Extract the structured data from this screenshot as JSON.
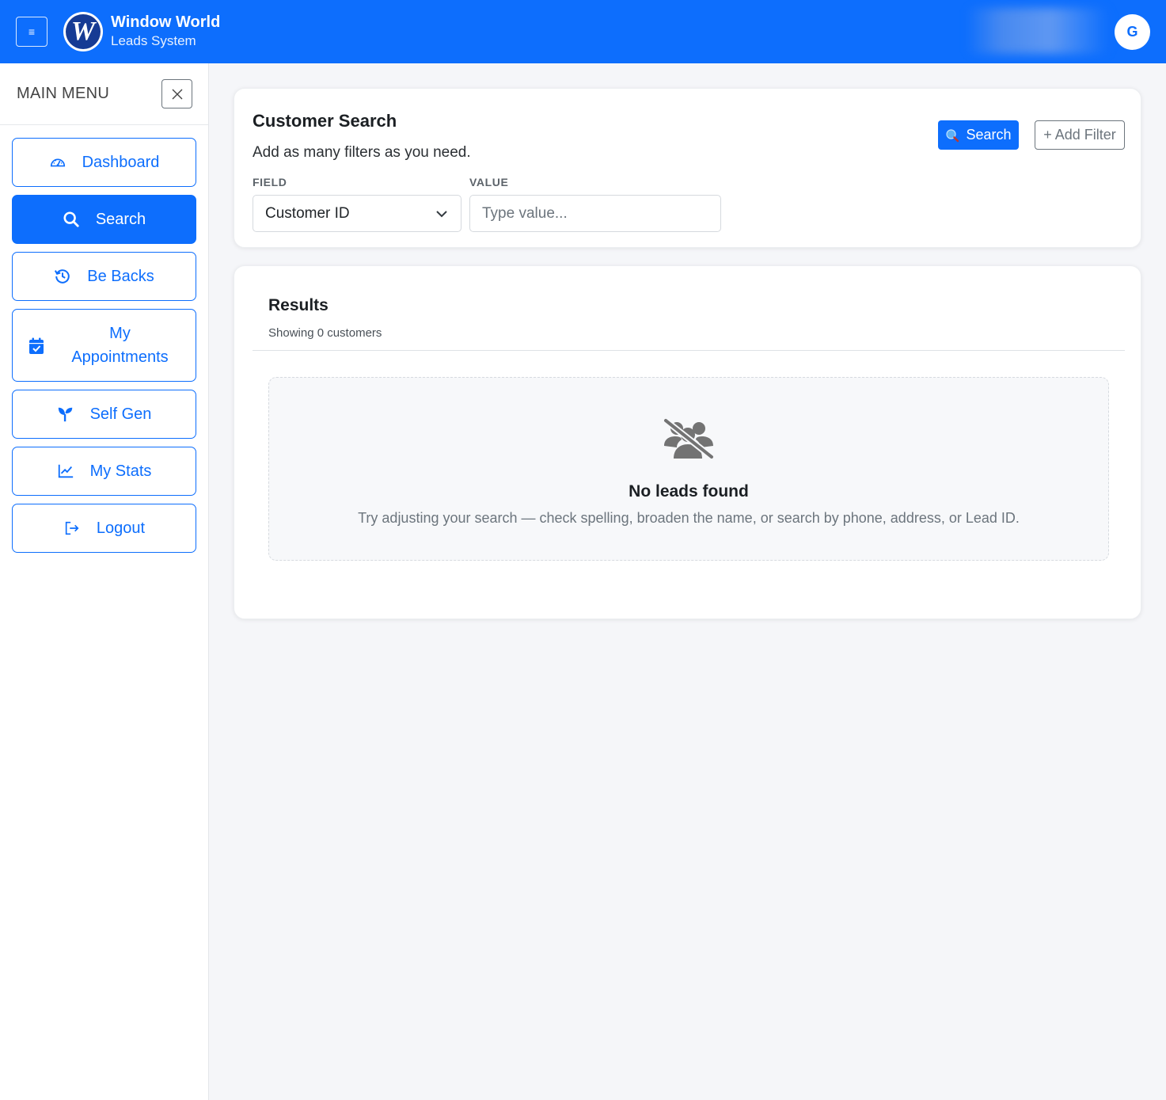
{
  "header": {
    "menu_toggle": "≡",
    "logo_letter": "W",
    "brand_title": "Window World",
    "brand_subtitle": "Leads System",
    "avatar_initial": "G"
  },
  "sidebar": {
    "title": "MAIN MENU",
    "items": [
      {
        "label": "Dashboard",
        "icon": "gauge-icon"
      },
      {
        "label": "Search",
        "icon": "search-icon",
        "active": true
      },
      {
        "label": "Be Backs",
        "icon": "history-icon"
      },
      {
        "label": "My Appointments",
        "icon": "calendar-check-icon"
      },
      {
        "label": "Self Gen",
        "icon": "seedling-icon"
      },
      {
        "label": "My Stats",
        "icon": "chart-line-icon"
      },
      {
        "label": "Logout",
        "icon": "logout-icon"
      }
    ]
  },
  "search_card": {
    "title": "Customer Search",
    "subtitle": "Add as many filters as you need.",
    "search_button": "Search",
    "add_filter_button": "+ Add Filter",
    "field_label": "FIELD",
    "value_label": "VALUE",
    "field_selected": "Customer ID",
    "value_placeholder": "Type value..."
  },
  "results": {
    "title": "Results",
    "count_text": "Showing 0 customers",
    "empty_title": "No leads found",
    "empty_text": "Try adjusting your search — check spelling, broaden the name, or search by phone, address, or Lead ID."
  },
  "colors": {
    "primary": "#0d6efd",
    "sidebar_bg": "#ffffff",
    "page_bg": "#f5f6f9"
  }
}
